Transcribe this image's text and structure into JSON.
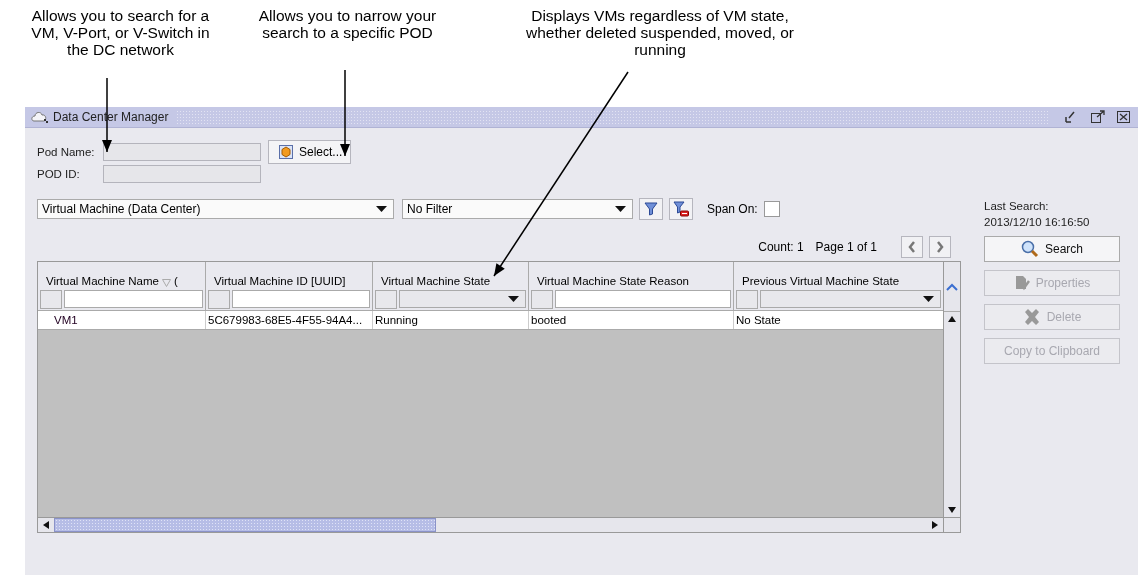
{
  "callouts": [
    {
      "text": "Allows you to search for a VM, V-Port, or V-Switch in the DC network"
    },
    {
      "text": "Allows you to narrow your search to a specific POD"
    },
    {
      "text": "Displays VMs regardless of VM state, whether deleted suspended, moved, or running"
    }
  ],
  "window": {
    "title": "Data Center Manager"
  },
  "pod_name": {
    "label": "Pod Name:"
  },
  "pod_id": {
    "label": "POD ID:"
  },
  "select_button": "Select...",
  "object_type": "Virtual Machine (Data Center)",
  "filter": "No Filter",
  "span_on": {
    "label": "Span On:",
    "checked": false
  },
  "pager": {
    "count": "Count: 1",
    "page": "Page 1 of 1"
  },
  "table": {
    "columns": [
      {
        "label": "Virtual Machine Name",
        "sort_suffix": "(",
        "sorted": true,
        "kind": "text"
      },
      {
        "label": "Virtual Machine ID [UUID]",
        "kind": "text"
      },
      {
        "label": "Virtual Machine State",
        "kind": "dropdown"
      },
      {
        "label": "Virtual Machine State Reason",
        "kind": "text"
      },
      {
        "label": "Previous Virtual Machine State",
        "kind": "dropdown"
      }
    ],
    "rows": [
      {
        "cells": [
          "VM1",
          "5C679983-68E5-4F55-94A4...",
          "Running",
          "booted",
          "No State"
        ]
      }
    ]
  },
  "last_search": {
    "label": "Last Search:",
    "time": "2013/12/10 16:16:50"
  },
  "actions": [
    {
      "label": "Search",
      "disabled": false
    },
    {
      "label": "Properties",
      "disabled": true
    },
    {
      "label": "Delete",
      "disabled": true
    },
    {
      "label": "Copy to Clipboard",
      "disabled": true
    }
  ]
}
